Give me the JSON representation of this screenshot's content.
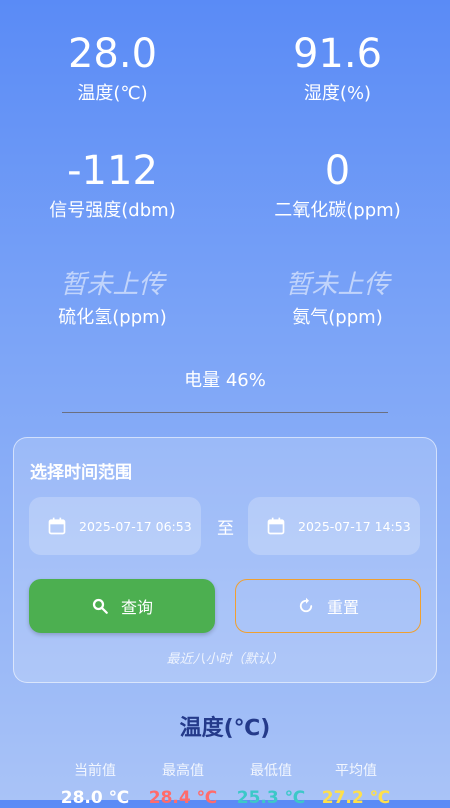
{
  "metrics": {
    "temperature": {
      "value": "28.0",
      "label": "温度(℃)"
    },
    "humidity": {
      "value": "91.6",
      "label": "湿度(%)"
    },
    "signal": {
      "value": "-112",
      "label": "信号强度(dbm)"
    },
    "co2": {
      "value": "0",
      "label": "二氧化碳(ppm)"
    },
    "h2s": {
      "value": "暂未上传",
      "label": "硫化氢(ppm)"
    },
    "nh3": {
      "value": "暂未上传",
      "label": "氨气(ppm)"
    }
  },
  "battery": "电量 46%",
  "range": {
    "title": "选择时间范围",
    "start": "2025-07-17 06:53",
    "to": "至",
    "end": "2025-07-17 14:53",
    "query_label": "查询",
    "reset_label": "重置",
    "hint": "最近八小时（默认）"
  },
  "section": {
    "title": "温度(℃)",
    "stats": [
      {
        "label": "当前值",
        "value": "28.0 ℃",
        "color": "#ffffff"
      },
      {
        "label": "最高值",
        "value": "28.4 ℃",
        "color": "#ff6b6b"
      },
      {
        "label": "最低值",
        "value": "25.3 ℃",
        "color": "#3cc8c8"
      },
      {
        "label": "平均值",
        "value": "27.2 ℃",
        "color": "#ffe04a"
      }
    ]
  }
}
